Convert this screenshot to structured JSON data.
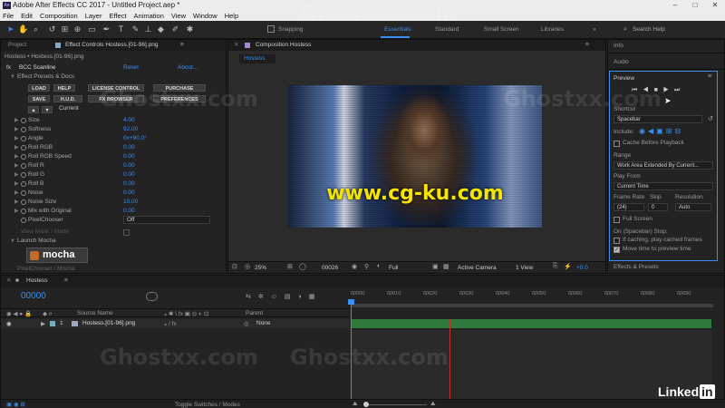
{
  "app": {
    "title": "Adobe After Effects CC 2017 - Untitled Project.aep *",
    "logo": "Ae"
  },
  "menu": [
    "File",
    "Edit",
    "Composition",
    "Layer",
    "Effect",
    "Animation",
    "View",
    "Window",
    "Help"
  ],
  "toolbar": {
    "snapping_label": "Snapping",
    "workspaces": [
      "Essentials",
      "Standard",
      "Small Screen",
      "Libraries"
    ],
    "active_workspace": "Essentials",
    "search_placeholder": "Search Help"
  },
  "left_panel": {
    "tab_project": "Project",
    "tab_effect_controls": "Effect Controls Hostess.[01-96].png",
    "breadcrumb": "Hostess • Hostess.[01-96].png",
    "effect_name": "BCC Scanline",
    "reset": "Reset",
    "about": "About...",
    "presets": "Effect Presets & Docs",
    "buttons_row1": [
      "LOAD",
      "HELP",
      "LICENSE CONTROL",
      "PURCHASE"
    ],
    "buttons_row2": [
      "SAVE",
      "H.U.D.",
      "FX BROWSER",
      "PREFERENCES"
    ],
    "current_label": "Current",
    "params": [
      {
        "label": "Size",
        "value": "4.00"
      },
      {
        "label": "Softness",
        "value": "92.00"
      },
      {
        "label": "Angle",
        "value": "0x+90.0°"
      },
      {
        "label": "Roll RGB",
        "value": "0.00"
      },
      {
        "label": "Roll RGB Speed",
        "value": "0.00"
      },
      {
        "label": "Roll R",
        "value": "0.00"
      },
      {
        "label": "Roll G",
        "value": "0.00"
      },
      {
        "label": "Roll B",
        "value": "0.00"
      },
      {
        "label": "Noise",
        "value": "0.00"
      },
      {
        "label": "Noise Size",
        "value": "10.00"
      },
      {
        "label": "Mix with Original",
        "value": "0.00"
      },
      {
        "label": "PixelChooser",
        "value": "Off"
      }
    ],
    "view_mask": "View Mask / Matte",
    "launch_mocha": "Launch Mocha",
    "mocha_label": "mocha",
    "pixelchooser_mocha": "PixelChooser / Mocha"
  },
  "composition": {
    "tab_label": "Composition Hostess",
    "comp_tab": "Hostess",
    "overlay_text": "www.cg-ku.com",
    "zoom": "25%",
    "timecode": "00026",
    "resolution": "Full",
    "camera": "Active Camera",
    "view": "1 View",
    "exposure": "+0.0"
  },
  "right_panel": {
    "info": "Info",
    "audio": "Audio",
    "preview": "Preview",
    "shortcut_label": "Shortcut",
    "shortcut_value": "Spacebar",
    "include_label": "Include:",
    "cache_before": "Cache Before Playback",
    "range_label": "Range",
    "range_value": "Work Area Extended By Current...",
    "play_from_label": "Play From",
    "play_from_value": "Current Time",
    "frame_rate_label": "Frame Rate",
    "skip_label": "Skip",
    "resolution_label": "Resolution",
    "frame_rate_value": "(24)",
    "skip_value": "0",
    "resolution_value": "Auto",
    "full_screen": "Full Screen",
    "on_stop_label": "On (Spacebar) Stop:",
    "if_caching": "If caching, play cached frames",
    "move_time": "Move time to preview time",
    "effects_presets": "Effects & Presets"
  },
  "timeline": {
    "tab": "Hostess",
    "timecode": "00000",
    "col_source": "Source Name",
    "col_parent": "Parent",
    "layer_index": "1",
    "layer_name": "Hostess.[01-96].png",
    "layer_parent": "None",
    "ruler": [
      "00000",
      "00010",
      "00020",
      "00030",
      "00040",
      "00050",
      "00060",
      "00070",
      "00080",
      "00090"
    ],
    "toggle": "Toggle Switches / Modes"
  },
  "watermarks": [
    "Ghostxx.com",
    "Ghostxx.com",
    "Ghostxx.com",
    "Ghostxx.com",
    "Ghostxx.com"
  ],
  "brand": "Linked",
  "brand_in": "in",
  "colors": {
    "accent": "#3a8ff0",
    "overlay_text": "#f5e400",
    "playhead": "#c23030",
    "layer_bar": "#2f7a3c"
  }
}
